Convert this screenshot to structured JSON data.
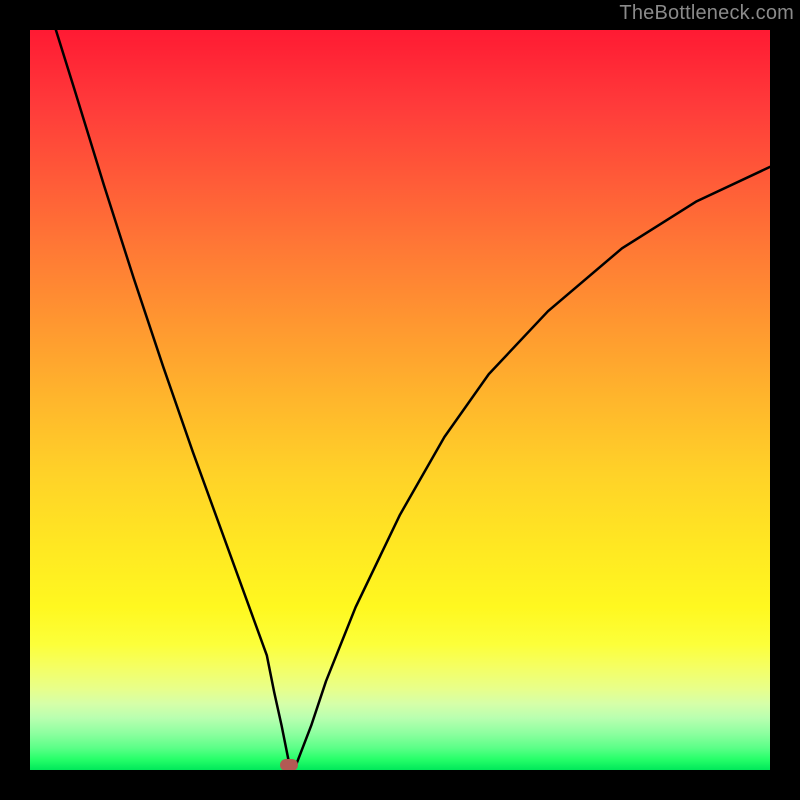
{
  "watermark": "TheBottleneck.com",
  "chart_data": {
    "type": "line",
    "title": "",
    "xlabel": "",
    "ylabel": "",
    "xlim": [
      0,
      100
    ],
    "ylim": [
      0,
      100
    ],
    "grid": false,
    "legend": false,
    "minimum_marker": {
      "x": 35,
      "y": 0.7,
      "color": "#b25a54"
    },
    "background_gradient_stops": [
      {
        "pct": 0,
        "color": "#ff1a33"
      },
      {
        "pct": 50,
        "color": "#ffd228"
      },
      {
        "pct": 83,
        "color": "#fcff3a"
      },
      {
        "pct": 100,
        "color": "#00e85a"
      }
    ],
    "series": [
      {
        "name": "bottleneck-curve",
        "color": "#000000",
        "x": [
          3.5,
          6,
          10,
          14,
          18,
          22,
          26,
          30,
          32,
          33,
          34,
          35,
          36,
          38,
          40,
          44,
          50,
          56,
          62,
          70,
          80,
          90,
          100
        ],
        "y": [
          100,
          92,
          79,
          66.5,
          54.5,
          43,
          32,
          21,
          15.5,
          10.5,
          6,
          1,
          0.8,
          6,
          12,
          22,
          34.5,
          45,
          53.5,
          62,
          70.5,
          76.8,
          81.5
        ]
      }
    ]
  }
}
